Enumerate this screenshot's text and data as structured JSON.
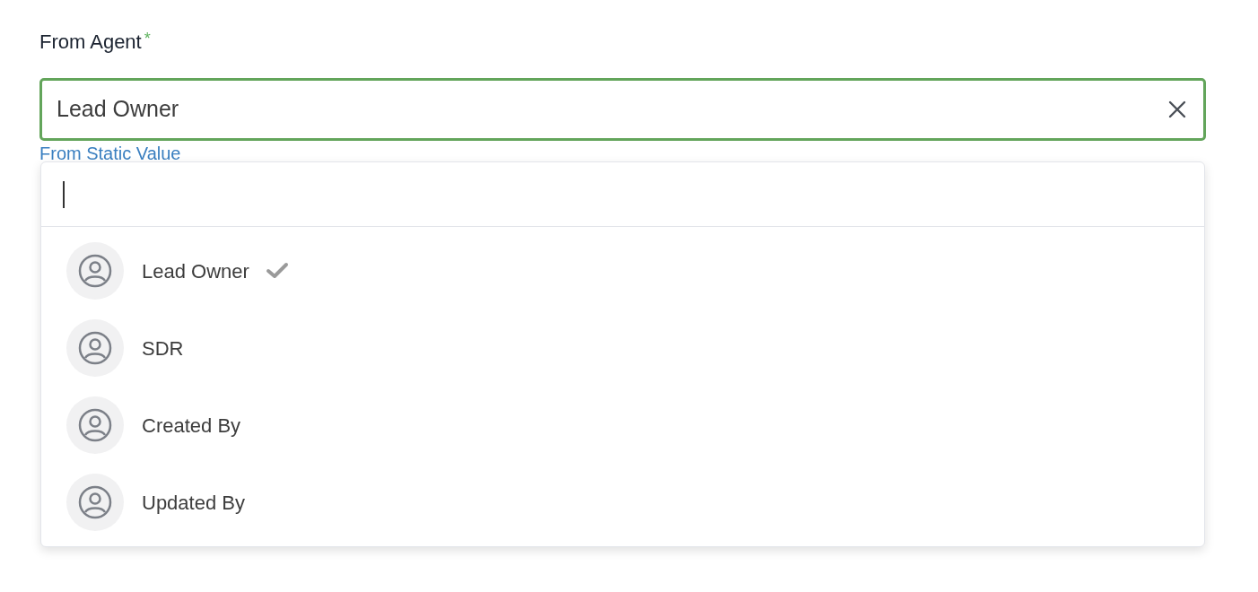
{
  "field": {
    "label": "From Agent",
    "required_mark": "*",
    "value": "Lead Owner",
    "focused": true
  },
  "link": "From Static Value",
  "dropdown": {
    "options": [
      {
        "label": "Lead Owner",
        "selected": true
      },
      {
        "label": "SDR",
        "selected": false
      },
      {
        "label": "Created By",
        "selected": false
      },
      {
        "label": "Updated By",
        "selected": false
      }
    ]
  }
}
